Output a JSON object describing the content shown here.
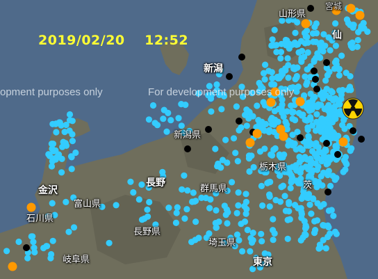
{
  "map": {
    "timestamp": "2019/02/20    12:52",
    "watermark_left": "opment purposes only",
    "watermark_right": "For development purposes only",
    "labels": {
      "yamagata": "山形県",
      "miyagi": "宮城",
      "sendai": "仙",
      "niigata_city": "新潟",
      "niigata_pref": "新潟県",
      "nagano_city": "長野",
      "nagano_pref": "長野県",
      "toyama": "富山県",
      "kanazawa": "金沢",
      "ishikawa": "石川県",
      "tochigi": "栃木県",
      "gunma": "群馬県",
      "saitama": "埼玉県",
      "tokyo": "東京",
      "gifu": "岐阜県",
      "ibaraki": "茨"
    },
    "colors": {
      "sea": "#4f6a8a",
      "land": "#6f6e5c",
      "monitor_normal": "#33ccff",
      "monitor_elevated": "#ff9900",
      "monitor_offline": "#000000",
      "nuclear_symbol": "#ffd400"
    },
    "icon": "radiation-icon"
  }
}
